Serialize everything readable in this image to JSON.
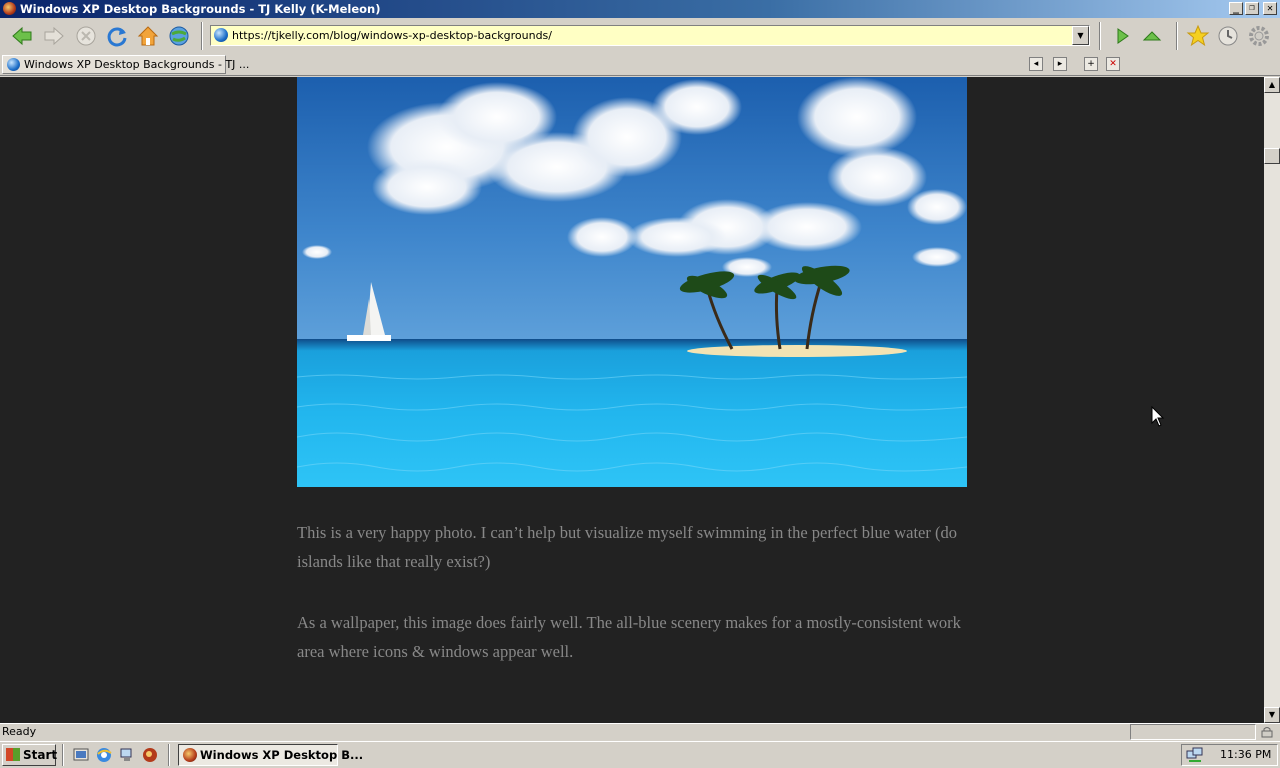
{
  "window": {
    "title": "Windows XP Desktop Backgrounds - TJ Kelly (K-Meleon)",
    "minimize_glyph": "_",
    "maximize_glyph": "❐",
    "close_glyph": "✕"
  },
  "toolbar": {
    "buttons": [
      "back-icon",
      "forward-icon",
      "stop-icon",
      "reload-icon",
      "home-icon",
      "go-globe-icon"
    ],
    "url": "https://tjkelly.com/blog/windows-xp-desktop-backgrounds/",
    "url_dropdown_glyph": "▼",
    "right_buttons": [
      "go-arrow-icon",
      "up-arrow-icon",
      "bookmark-star-icon",
      "history-clock-icon",
      "settings-gear-icon"
    ]
  },
  "tabs": {
    "active_label": "Windows XP Desktop Backgrounds - TJ ...",
    "controls": [
      "tab-prev-icon",
      "tab-next-icon",
      "new-tab-icon",
      "close-tab-icon"
    ]
  },
  "article": {
    "image_alt": "Tropical island with palm trees, sailboat and turquoise sea",
    "paragraph_1": "This is a very happy photo. I can’t help but visualize myself swimming in the perfect blue water (do islands like that really exist?)",
    "paragraph_2": "As a wallpaper, this image does fairly well. The all-blue scenery makes for a mostly-consistent work area where icons & windows appear well.",
    "background_color": "#222222",
    "text_color": "#888888"
  },
  "scrollbar": {
    "up_glyph": "▲",
    "down_glyph": "▼"
  },
  "statusbar": {
    "text": "Ready"
  },
  "taskbar": {
    "start_label": "Start",
    "quick_launch": [
      "show-desktop-icon",
      "ie-icon",
      "network-icon",
      "kmeleon-icon"
    ],
    "task_label": "Windows XP Desktop B...",
    "clock": "11:36 PM"
  }
}
